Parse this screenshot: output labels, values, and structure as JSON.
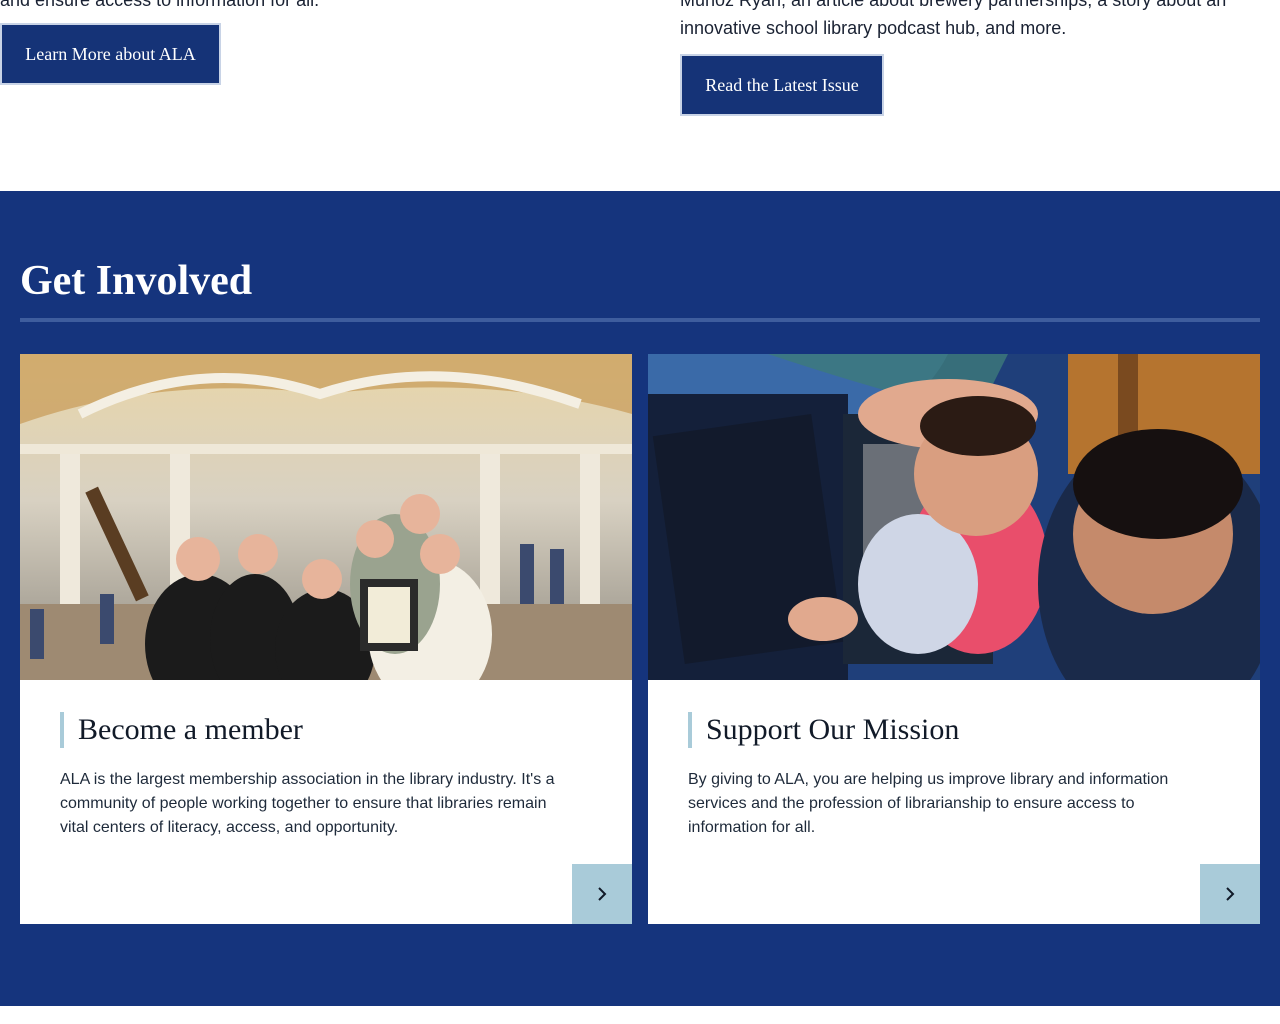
{
  "top": {
    "left_text": "and ensure access to information for all.",
    "left_button": "Learn More about ALA",
    "right_text_line1": "Muñoz Ryan, an article about brewery partnerships, a story about an",
    "right_text_line2": "innovative school library podcast hub, and more.",
    "right_button": "Read the Latest Issue"
  },
  "get_involved": {
    "title": "Get Involved",
    "cards": [
      {
        "title": "Become a member",
        "body": "ALA is the largest membership association in the library industry. It's a community of people working together to ensure that libraries remain vital centers of literacy, access, and opportunity.",
        "icon": "chevron-right-icon"
      },
      {
        "title": "Support Our Mission",
        "body": "By giving to ALA, you are helping us improve library and information services and the profession of librarianship to ensure access to information for all.",
        "icon": "chevron-right-icon"
      }
    ]
  },
  "colors": {
    "navy": "#15347d",
    "button": "#153377",
    "accent": "#a9cbd9"
  }
}
